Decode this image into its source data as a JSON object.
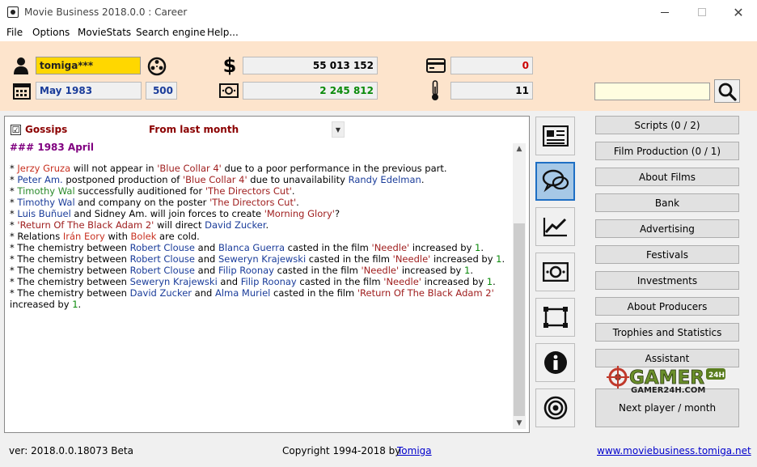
{
  "window": {
    "title": "Movie Business 2018.0.0 : Career"
  },
  "menu": {
    "items": [
      "File",
      "Options",
      "MovieStats",
      "Search engine",
      "Help..."
    ]
  },
  "header": {
    "player_name": "tomiga***",
    "date": "May 1983",
    "turn": "500",
    "money": "55 013 152",
    "cash": "2 245 812",
    "debt": "0",
    "temperature": "11",
    "search_value": "",
    "colors": {
      "background": "#fde4cc",
      "name_field": "#ffd700",
      "cash_value": "#0a8a0a",
      "debt_value": "#cc0000"
    }
  },
  "content": {
    "gossips_label": "Gossips",
    "gossips_checked": "☑",
    "period": "From last month",
    "heading": "### 1983 April",
    "lines": [
      [
        {
          "t": "* "
        },
        {
          "t": "Jerzy Gruza",
          "c": "r"
        },
        {
          "t": " will not appear in "
        },
        {
          "t": "'Blue Collar 4'",
          "c": "f"
        },
        {
          "t": " due to a poor performance in the previous part."
        }
      ],
      [
        {
          "t": "* "
        },
        {
          "t": "Peter Am.",
          "c": "p"
        },
        {
          "t": " postponed production of "
        },
        {
          "t": "'Blue Collar 4'",
          "c": "f"
        },
        {
          "t": " due to unavailability "
        },
        {
          "t": "Randy Edelman",
          "c": "p"
        },
        {
          "t": "."
        }
      ],
      [
        {
          "t": "* "
        },
        {
          "t": "Timothy Wal",
          "c": "g"
        },
        {
          "t": " successfully auditioned for "
        },
        {
          "t": "'The Directors Cut'",
          "c": "f"
        },
        {
          "t": "."
        }
      ],
      [
        {
          "t": "* "
        },
        {
          "t": "Timothy Wal",
          "c": "p"
        },
        {
          "t": " and company on the poster "
        },
        {
          "t": "'The Directors Cut'",
          "c": "f"
        },
        {
          "t": "."
        }
      ],
      [
        {
          "t": "* "
        },
        {
          "t": "Luis Buñuel",
          "c": "p"
        },
        {
          "t": " and Sidney Am. will join forces to create "
        },
        {
          "t": "'Morning Glory'",
          "c": "f"
        },
        {
          "t": "?"
        }
      ],
      [
        {
          "t": "* "
        },
        {
          "t": "'Return Of The Black Adam 2'",
          "c": "f"
        },
        {
          "t": " will direct "
        },
        {
          "t": "David Zucker",
          "c": "p"
        },
        {
          "t": "."
        }
      ],
      [
        {
          "t": "* Relations "
        },
        {
          "t": "Irán Eory",
          "c": "r"
        },
        {
          "t": " with "
        },
        {
          "t": "Bolek",
          "c": "r"
        },
        {
          "t": " are cold."
        }
      ],
      [
        {
          "t": "* The chemistry between "
        },
        {
          "t": "Robert Clouse",
          "c": "p"
        },
        {
          "t": " and "
        },
        {
          "t": "Blanca Guerra",
          "c": "p"
        },
        {
          "t": " casted in the film "
        },
        {
          "t": "'Needle'",
          "c": "f"
        },
        {
          "t": " increased by "
        },
        {
          "t": "1",
          "c": "n"
        },
        {
          "t": "."
        }
      ],
      [
        {
          "t": "* The chemistry between "
        },
        {
          "t": "Robert Clouse",
          "c": "p"
        },
        {
          "t": " and "
        },
        {
          "t": "Seweryn Krajewski",
          "c": "p"
        },
        {
          "t": " casted in the film "
        },
        {
          "t": "'Needle'",
          "c": "f"
        },
        {
          "t": " increased by "
        },
        {
          "t": "1",
          "c": "n"
        },
        {
          "t": "."
        }
      ],
      [
        {
          "t": "* The chemistry between "
        },
        {
          "t": "Robert Clouse",
          "c": "p"
        },
        {
          "t": " and "
        },
        {
          "t": "Filip Roonay",
          "c": "p"
        },
        {
          "t": " casted in the film "
        },
        {
          "t": "'Needle'",
          "c": "f"
        },
        {
          "t": " increased by "
        },
        {
          "t": "1",
          "c": "n"
        },
        {
          "t": "."
        }
      ],
      [
        {
          "t": "* The chemistry between "
        },
        {
          "t": "Seweryn Krajewski",
          "c": "p"
        },
        {
          "t": " and "
        },
        {
          "t": "Filip Roonay",
          "c": "p"
        },
        {
          "t": " casted in the film "
        },
        {
          "t": "'Needle'",
          "c": "f"
        },
        {
          "t": " increased by "
        },
        {
          "t": "1",
          "c": "n"
        },
        {
          "t": "."
        }
      ],
      [
        {
          "t": "* The chemistry between "
        },
        {
          "t": "David Zucker",
          "c": "p"
        },
        {
          "t": " and "
        },
        {
          "t": "Alma Muriel",
          "c": "p"
        },
        {
          "t": " casted in the film "
        },
        {
          "t": "'Return Of The Black Adam 2'",
          "c": "f"
        }
      ],
      [
        {
          "t": "increased by "
        },
        {
          "t": "1",
          "c": "n"
        },
        {
          "t": "."
        }
      ]
    ]
  },
  "icon_column": {
    "icons": [
      "newspaper-icon",
      "chat-bubbles-icon",
      "chart-line-icon",
      "banknote-icon",
      "crop-frame-icon",
      "info-icon",
      "target-icon"
    ],
    "active": "chat-bubbles-icon"
  },
  "buttons": {
    "scripts": "Scripts (0 / 2)",
    "film_production": "Film Production (0 / 1)",
    "about_films": "About Films",
    "bank": "Bank",
    "advertising": "Advertising",
    "festivals": "Festivals",
    "investments": "Investments",
    "about_producers": "About Producers",
    "trophies": "Trophies and Statistics",
    "assistant": "Assistant",
    "next": "Next player / month"
  },
  "watermark": {
    "main": "GAMER",
    "badge": "24H",
    "domain": "GAMER24H.COM"
  },
  "status": {
    "version": "ver: 2018.0.0.18073 Beta",
    "copyright": "Copyright 1994-2018 by",
    "author": "Tomiga",
    "website": "www.moviebusiness.tomiga.net"
  }
}
